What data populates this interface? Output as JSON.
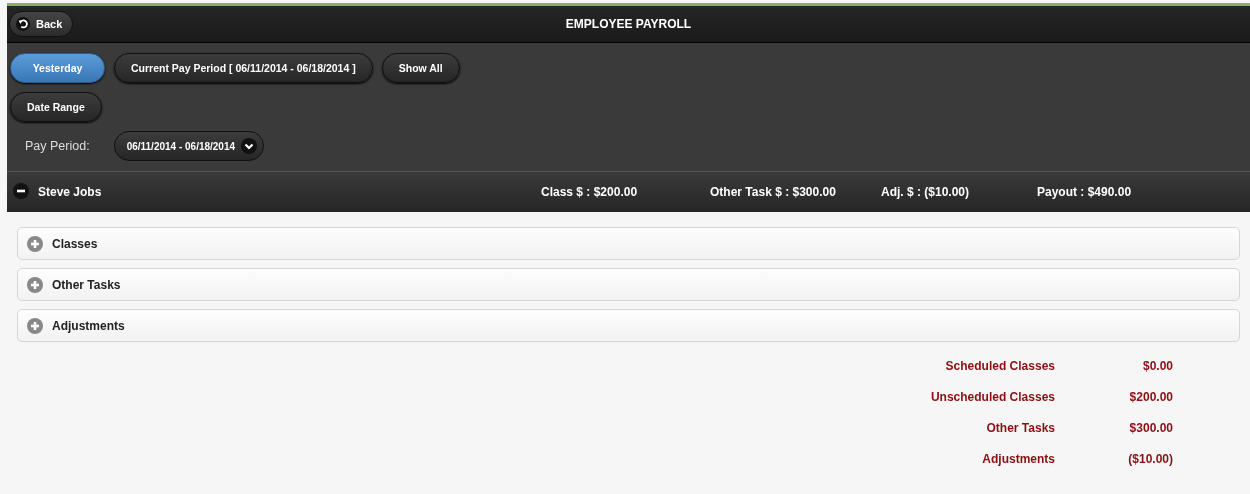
{
  "header": {
    "back": "Back",
    "title": "EMPLOYEE PAYROLL"
  },
  "filters": [
    {
      "label": "Yesterday",
      "selected": true
    },
    {
      "label": "Current Pay Period [ 06/11/2014 - 06/18/2014 ]",
      "selected": false
    },
    {
      "label": "Show All",
      "selected": false
    },
    {
      "label": "Date Range",
      "selected": false
    }
  ],
  "pay_period": {
    "label": "Pay Period:",
    "value": "06/11/2014 - 06/18/2014"
  },
  "employee": {
    "name": "Steve Jobs",
    "expanded": true,
    "stats": [
      "Class $ : $200.00",
      "Other Task $ : $300.00",
      "Adj. $ : ($10.00)",
      "Payout : $490.00"
    ]
  },
  "sections": [
    {
      "title": "Classes",
      "expanded": false
    },
    {
      "title": "Other Tasks",
      "expanded": false
    },
    {
      "title": "Adjustments",
      "expanded": false
    }
  ],
  "summary": [
    {
      "label": "Scheduled Classes",
      "value": "$0.00"
    },
    {
      "label": "Unscheduled Classes",
      "value": "$200.00"
    },
    {
      "label": "Other Tasks",
      "value": "$300.00"
    },
    {
      "label": "Adjustments",
      "value": "($10.00)"
    }
  ]
}
